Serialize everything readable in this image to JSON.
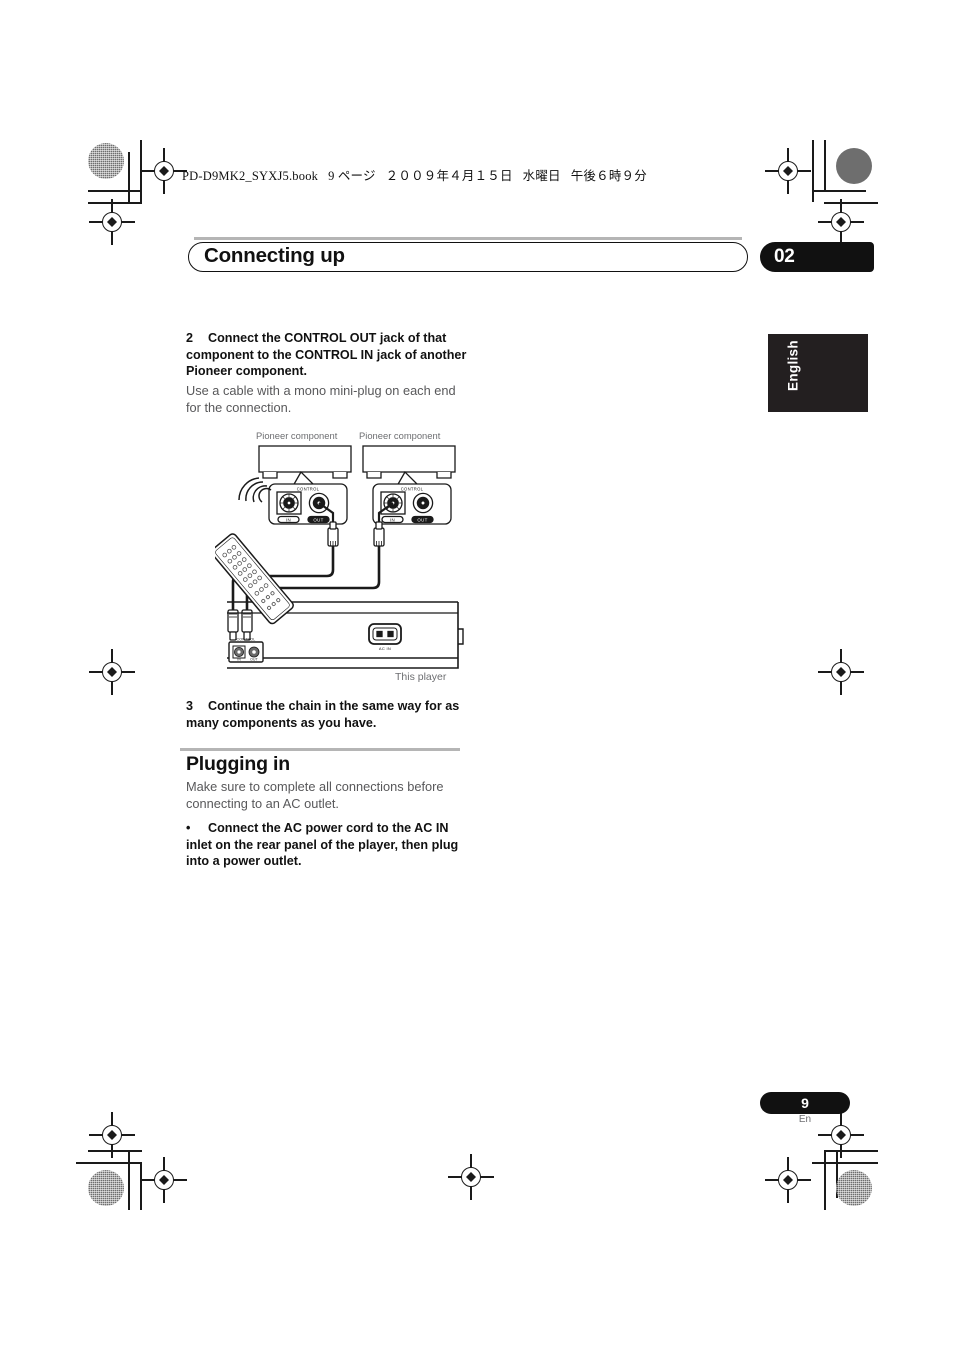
{
  "print_info": {
    "file_line": "PD-D9MK2_SYXJ5.book   9 ページ   ２００９年４月１５日   水曜日   午後６時９分"
  },
  "chapter": {
    "title": "Connecting up",
    "number": "02"
  },
  "language_tab": {
    "label": "English"
  },
  "steps": [
    {
      "number": "2",
      "bold_text": "Connect the CONTROL OUT jack of that component to the CONTROL IN jack of another Pioneer component.",
      "body_text": "Use a cable with a mono mini-plug on each end for the connection."
    },
    {
      "number": "3",
      "bold_text": "Continue the chain in the same way for as many components as you have.",
      "body_text": ""
    }
  ],
  "diagram": {
    "label_component_left": "Pioneer component",
    "label_component_right": "Pioneer component",
    "label_this_player": "This player",
    "jack_group_label": "CONTROL",
    "jack_in_label": "IN",
    "jack_out_label": "OUT",
    "ac_inlet_label": "AC IN",
    "player_control_label": "CONTROL",
    "player_jack_in": "IN",
    "player_jack_out": "OUT"
  },
  "section": {
    "title": "Plugging in",
    "intro": "Make sure to complete all connections before connecting to an AC outlet.",
    "bullet_marker": "•",
    "bullet_text": "Connect the AC power cord to the AC IN inlet on the rear panel of the player, then plug into a power outlet."
  },
  "footer": {
    "page_number": "9",
    "language_code": "En"
  },
  "colors": {
    "accent_black": "#111111",
    "body_gray": "#58585a",
    "rule_gray": "#b5b5b5",
    "tab_black": "#231f20"
  }
}
